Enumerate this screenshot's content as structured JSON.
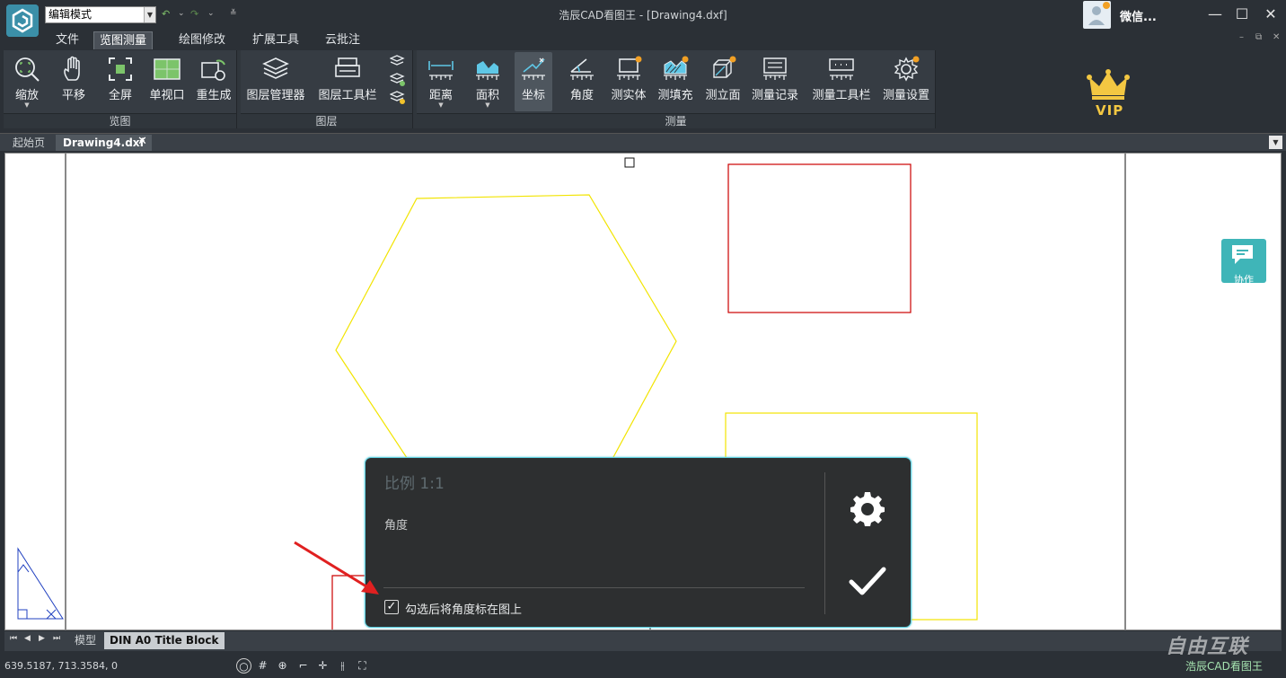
{
  "title_bar": {
    "mode_value": "编辑模式",
    "window_title": "浩辰CAD看图王 - [Drawing4.dxf]",
    "user_name": "微信..."
  },
  "menu": {
    "tabs": [
      "文件",
      "览图测量",
      "绘图修改",
      "扩展工具",
      "云批注"
    ],
    "active_tab": "览图测量"
  },
  "ribbon": {
    "groups": [
      {
        "label": "览图",
        "buttons": [
          "缩放",
          "平移",
          "全屏",
          "单视口",
          "重生成"
        ]
      },
      {
        "label": "图层",
        "buttons": [
          "图层管理器",
          "图层工具栏"
        ]
      },
      {
        "label": "测量",
        "buttons": [
          "距离",
          "面积",
          "坐标",
          "角度",
          "测实体",
          "测填充",
          "测立面",
          "测量记录",
          "测量工具栏",
          "测量设置"
        ]
      }
    ],
    "active_button": "坐标"
  },
  "vip": {
    "label": "VIP"
  },
  "doc_tabs": [
    "起始页",
    "Drawing4.dxf"
  ],
  "active_doc_tab": "Drawing4.dxf",
  "collab": {
    "label": "协作"
  },
  "measure_dialog": {
    "scale": "比例 1:1",
    "angle_label": "角度",
    "show_angle_checked": true,
    "show_angle_label": "勾选后将角度标在图上"
  },
  "layout_tabs": [
    "模型",
    "DIN A0 Title Block"
  ],
  "active_layout_tab": "模型",
  "status": {
    "coords": "639.5187, 713.3584, 0",
    "brand": "浩辰CAD看图王",
    "watermark": "自由互联"
  },
  "colors": {
    "accent": "#3fb5b8",
    "dialog_border": "#5fd0e0",
    "shape_yellow": "#f2e400",
    "shape_red": "#cc0000",
    "vip_gold": "#f3c742"
  }
}
